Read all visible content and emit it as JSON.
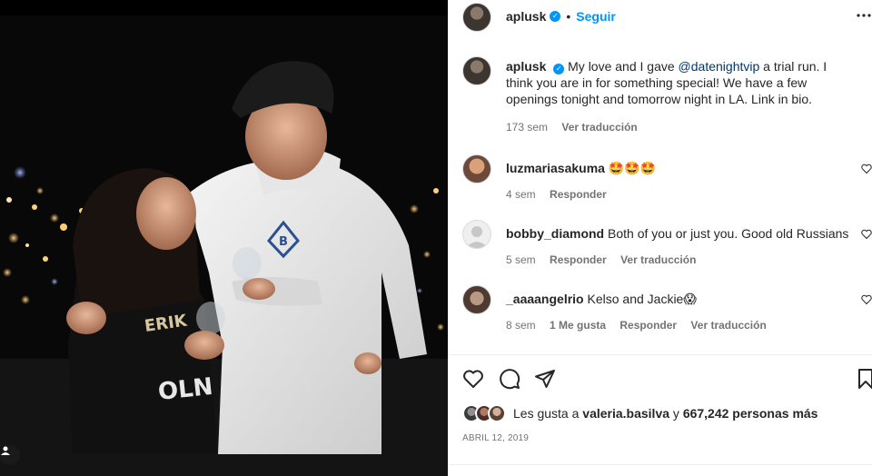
{
  "post": {
    "username": "aplusk",
    "verified_mark": "✓",
    "dot": "•",
    "follow_label": "Seguir",
    "caption_before": "My love and I gave ",
    "caption_mention": "@datenightvip",
    "caption_after": " a trial run. I think you are in for something special! We have a few openings tonight and tomorrow night in LA. Link in bio.",
    "caption_time": "173 sem",
    "caption_translate": "Ver traducción"
  },
  "comments": [
    {
      "username": "luzmariasakuma",
      "text": "🤩🤩🤩",
      "time": "4 sem",
      "reply": "Responder"
    },
    {
      "username": "bobby_diamond",
      "text": "Both of you or just you. Good old Russians",
      "time": "5 sem",
      "reply": "Responder",
      "translate": "Ver traducción"
    },
    {
      "username": "_aaaangelrio",
      "text": "Kelso and Jackie😱",
      "time": "8 sem",
      "likes": "1 Me gusta",
      "reply": "Responder",
      "translate": "Ver traducción"
    }
  ],
  "likes": {
    "prefix": "Les gusta a",
    "user": "valeria.basilva",
    "joiner": "y",
    "others": "667,242 personas más"
  },
  "date": "ABRIL 12, 2019",
  "icons": {
    "like": "heart-icon",
    "comment": "comment-icon",
    "share": "send-icon",
    "save": "bookmark-icon",
    "more": "more-icon",
    "tag": "user-tag-icon"
  },
  "colors": {
    "accent": "#0095f6",
    "mention": "#00376b",
    "muted": "#737373"
  }
}
